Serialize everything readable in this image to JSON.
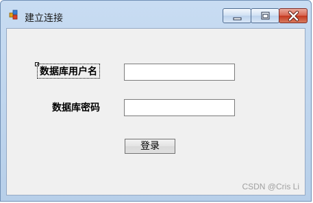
{
  "window": {
    "title": "建立连接"
  },
  "form": {
    "username_label": "数据库用户名",
    "password_label": "数据库密码",
    "username_value": "",
    "password_value": "",
    "login_label": "登录"
  },
  "watermark": "CSDN @Cris Li",
  "colors": {
    "client_background": "#f0f0f0",
    "close_button": "#c4381f",
    "titlebar": "#b7cfe9"
  }
}
